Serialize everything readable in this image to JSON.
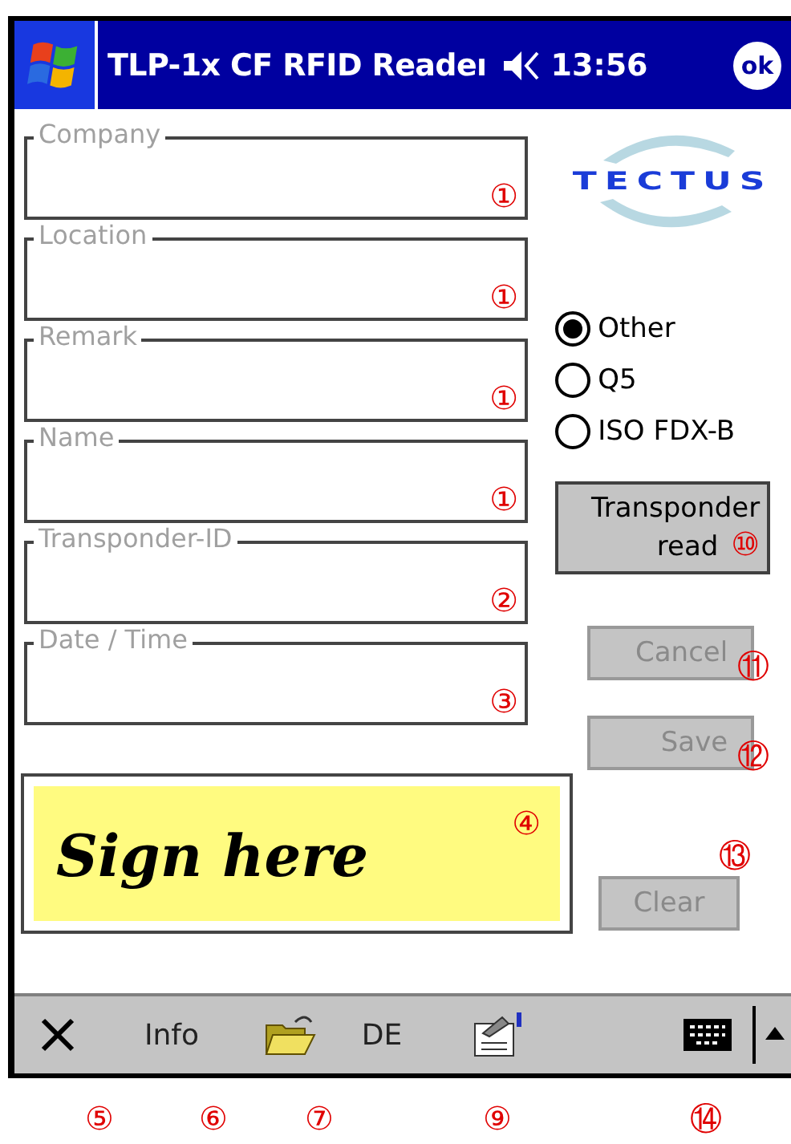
{
  "title_bar": {
    "title": "TLP-1x CF RFID Readeı",
    "time": "13:56",
    "ok": "ok"
  },
  "fields": [
    {
      "label": "Company",
      "marker": "①"
    },
    {
      "label": "Location",
      "marker": "①"
    },
    {
      "label": "Remark",
      "marker": "①"
    },
    {
      "label": "Name",
      "marker": "①"
    },
    {
      "label": "Transponder-ID",
      "marker": "②"
    },
    {
      "label": "Date / Time",
      "marker": "③"
    }
  ],
  "logo": {
    "text": "TECTUS"
  },
  "radios": [
    {
      "label": "Other",
      "selected": true
    },
    {
      "label": "Q5",
      "selected": false
    },
    {
      "label": "ISO FDX-B",
      "selected": false
    }
  ],
  "transponder_button": {
    "label": "Transponder read",
    "marker": "⑩",
    "disabled": false
  },
  "buttons": [
    {
      "label": "Cancel",
      "marker": "⑪",
      "disabled": true
    },
    {
      "label": "Save",
      "marker": "⑫",
      "disabled": true
    }
  ],
  "signature": {
    "text": "Sign here",
    "marker": "④"
  },
  "clear_button": {
    "label": "Clear",
    "marker": "⑬",
    "disabled": true
  },
  "toolbar": [
    {
      "kind": "close",
      "marker": "⑤"
    },
    {
      "kind": "text",
      "label": "Info",
      "marker": "⑥"
    },
    {
      "kind": "folder",
      "marker": "⑦"
    },
    {
      "kind": "text",
      "label": "DE"
    },
    {
      "kind": "form",
      "marker": "⑨"
    },
    {
      "kind": "keyboard",
      "marker": "⑭"
    }
  ]
}
